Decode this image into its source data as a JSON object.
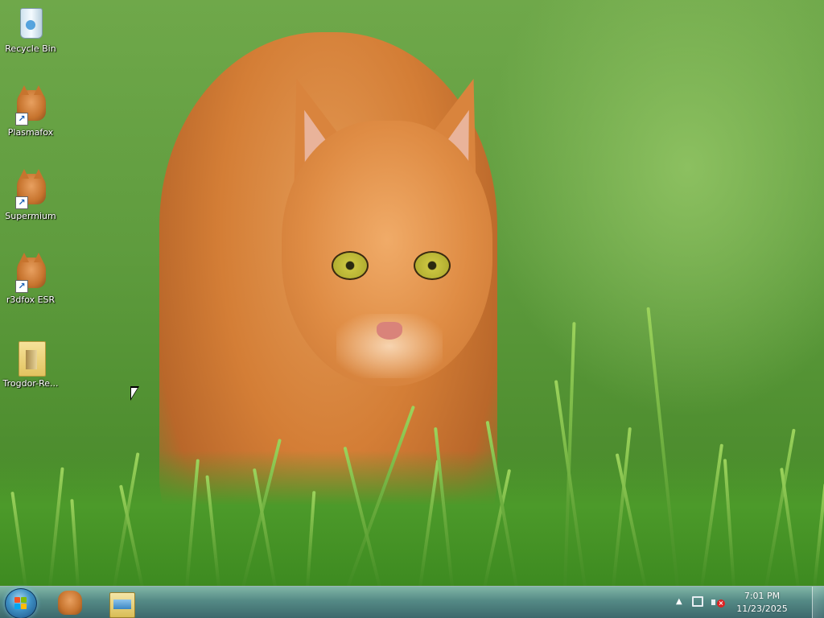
{
  "desktop": {
    "icons": [
      {
        "label": "Recycle Bin",
        "icon": "recycle-bin-icon"
      },
      {
        "label": "Plasmafox",
        "icon": "cat-browser-icon"
      },
      {
        "label": "Supermium",
        "icon": "cat-browser-icon"
      },
      {
        "label": "r3dfox ESR",
        "icon": "cat-browser-icon"
      },
      {
        "label": "Trogdor-Re...",
        "icon": "folder-icon"
      }
    ]
  },
  "taskbar": {
    "start_icon": "windows-orb-icon",
    "pinned": [
      {
        "name": "cat-browser-icon"
      },
      {
        "name": "file-explorer-icon"
      }
    ],
    "tray": {
      "show_hidden_icon": "up-arrow-icon",
      "network_icon": "network-icon",
      "volume_icon": "volume-muted-icon",
      "time": "7:01 PM",
      "date": "11/23/2025"
    }
  },
  "colors": {
    "grass": "#5f9c3e",
    "cat_orange": "#d47e36",
    "taskbar": "#5a8ca0"
  }
}
